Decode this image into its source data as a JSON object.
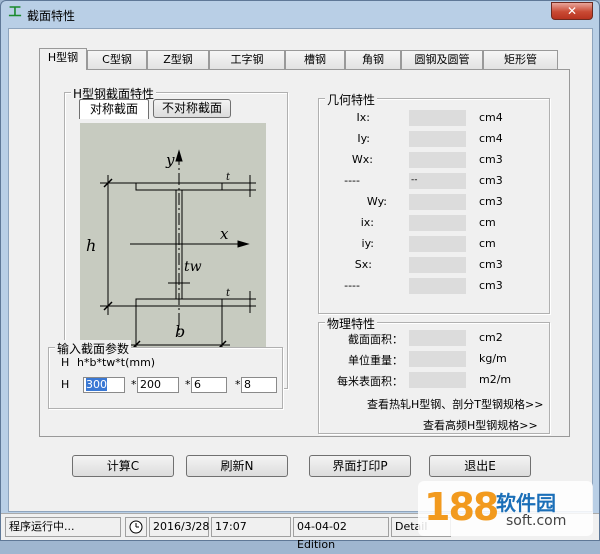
{
  "window": {
    "title": "截面特性",
    "close_label": "✕"
  },
  "tabs": [
    {
      "label": "H型钢",
      "active": true
    },
    {
      "label": "C型钢"
    },
    {
      "label": "Z型钢"
    },
    {
      "label": "工字钢"
    },
    {
      "label": "槽钢"
    },
    {
      "label": "角钢"
    },
    {
      "label": "圆钢及圆管"
    },
    {
      "label": "矩形管"
    }
  ],
  "h_section": {
    "group_title": "H型钢截面特性",
    "sym_button": "对称截面",
    "asym_button": "不对称截面",
    "diagram": {
      "y_axis": "y",
      "x_axis": "x",
      "h_label": "h",
      "b_label": "b",
      "tw_label": "tw",
      "t_label": "t"
    }
  },
  "input_group": {
    "title": "输入截面参数",
    "formula_prefix": "H",
    "formula": "h*b*tw*t(mm)",
    "row_label": "H",
    "times": "*",
    "values": [
      "300",
      "200",
      "6",
      "8"
    ]
  },
  "geometry": {
    "title": "几何特性",
    "rows": [
      {
        "label": "Ix:",
        "unit": "cm4"
      },
      {
        "label": "Iy:",
        "unit": "cm4"
      },
      {
        "label": "Wx:",
        "unit": "cm3"
      },
      {
        "label": "----",
        "mid": "--",
        "unit": "cm3"
      },
      {
        "label": "Wy:",
        "unit": "cm3"
      },
      {
        "label": "ix:",
        "unit": "cm"
      },
      {
        "label": "iy:",
        "unit": "cm"
      },
      {
        "label": "Sx:",
        "unit": "cm3"
      },
      {
        "label": "----",
        "unit": "cm3"
      }
    ]
  },
  "physical": {
    "title": "物理特性",
    "rows": [
      {
        "label": "截面面积：",
        "unit": "cm2"
      },
      {
        "label": "单位重量：",
        "unit": "kg/m"
      },
      {
        "label": "每米表面积：",
        "unit": "m2/m"
      }
    ],
    "link1": "查看热轧H型钢、剖分T型钢规格>>",
    "link2": "查看高频H型钢规格>>"
  },
  "buttons": {
    "calc": "计算C",
    "refresh": "刷新N",
    "print": "界面打印P",
    "exit": "退出E"
  },
  "status": {
    "running": "程序运行中...",
    "date": "2016/3/28",
    "time": "17:07",
    "edition": "04-04-02 Edition",
    "detail": "Detail"
  },
  "watermark": {
    "number": "188",
    "brand": "软件园",
    "site": "soft.com"
  }
}
